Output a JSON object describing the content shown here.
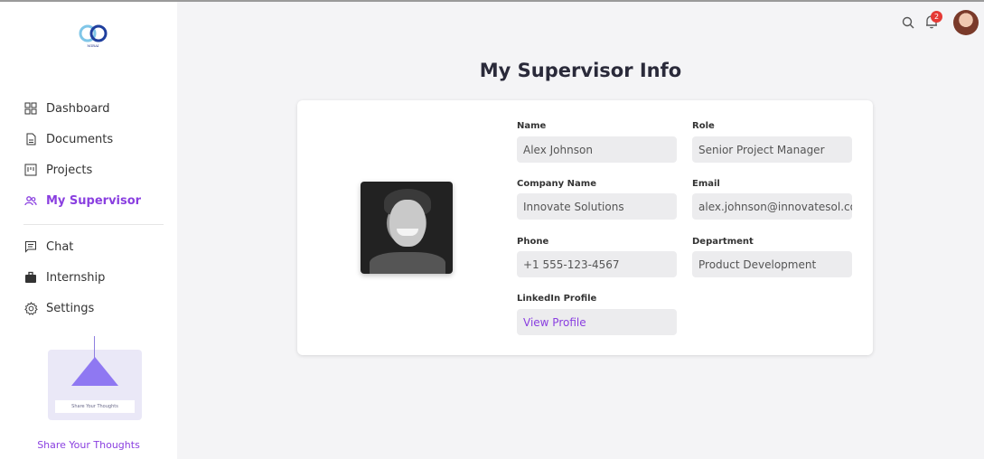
{
  "logo": {
    "text": "MIRAI"
  },
  "sidebar": {
    "items": [
      {
        "label": "Dashboard",
        "icon": "grid-icon"
      },
      {
        "label": "Documents",
        "icon": "document-icon"
      },
      {
        "label": "Projects",
        "icon": "projects-icon"
      },
      {
        "label": "My Supervisor",
        "icon": "supervisor-icon",
        "active": true
      },
      {
        "label": "Chat",
        "icon": "chat-icon"
      },
      {
        "label": "Internship",
        "icon": "briefcase-icon"
      },
      {
        "label": "Settings",
        "icon": "gear-icon"
      }
    ],
    "thoughts_card_button": "Share Your Thoughts",
    "thoughts_link": "Share Your Thoughts"
  },
  "header": {
    "notification_count": "2"
  },
  "page": {
    "title": "My Supervisor Info"
  },
  "supervisor": {
    "name_label": "Name",
    "name": "Alex Johnson",
    "role_label": "Role",
    "role": "Senior Project Manager",
    "company_label": "Company Name",
    "company": "Innovate Solutions",
    "email_label": "Email",
    "email": "alex.johnson@innovatesol.com",
    "phone_label": "Phone",
    "phone": "+1 555-123-4567",
    "department_label": "Department",
    "department": "Product Development",
    "linkedin_label": "LinkedIn Profile",
    "linkedin": "View Profile"
  },
  "colors": {
    "accent": "#8a3fe0",
    "badge": "#e53935",
    "background": "#f4f4f6"
  }
}
